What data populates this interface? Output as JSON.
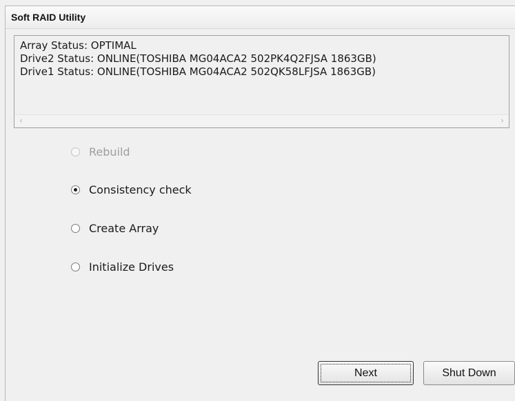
{
  "window": {
    "title": "Soft RAID Utility"
  },
  "status": {
    "lines": [
      "Array Status: OPTIMAL",
      "Drive2 Status: ONLINE(TOSHIBA MG04ACA2 502PK4Q2FJSA 1863GB)",
      "Drive1 Status: ONLINE(TOSHIBA MG04ACA2 502QK58LFJSA 1863GB)"
    ]
  },
  "options": [
    {
      "label": "Rebuild",
      "checked": false,
      "enabled": false
    },
    {
      "label": "Consistency check",
      "checked": true,
      "enabled": true
    },
    {
      "label": "Create Array",
      "checked": false,
      "enabled": true
    },
    {
      "label": "Initialize Drives",
      "checked": false,
      "enabled": true
    }
  ],
  "buttons": {
    "next": "Next",
    "shutdown": "Shut Down"
  },
  "icons": {
    "scroll_left": "chevron-left-icon",
    "scroll_right": "chevron-right-icon"
  }
}
